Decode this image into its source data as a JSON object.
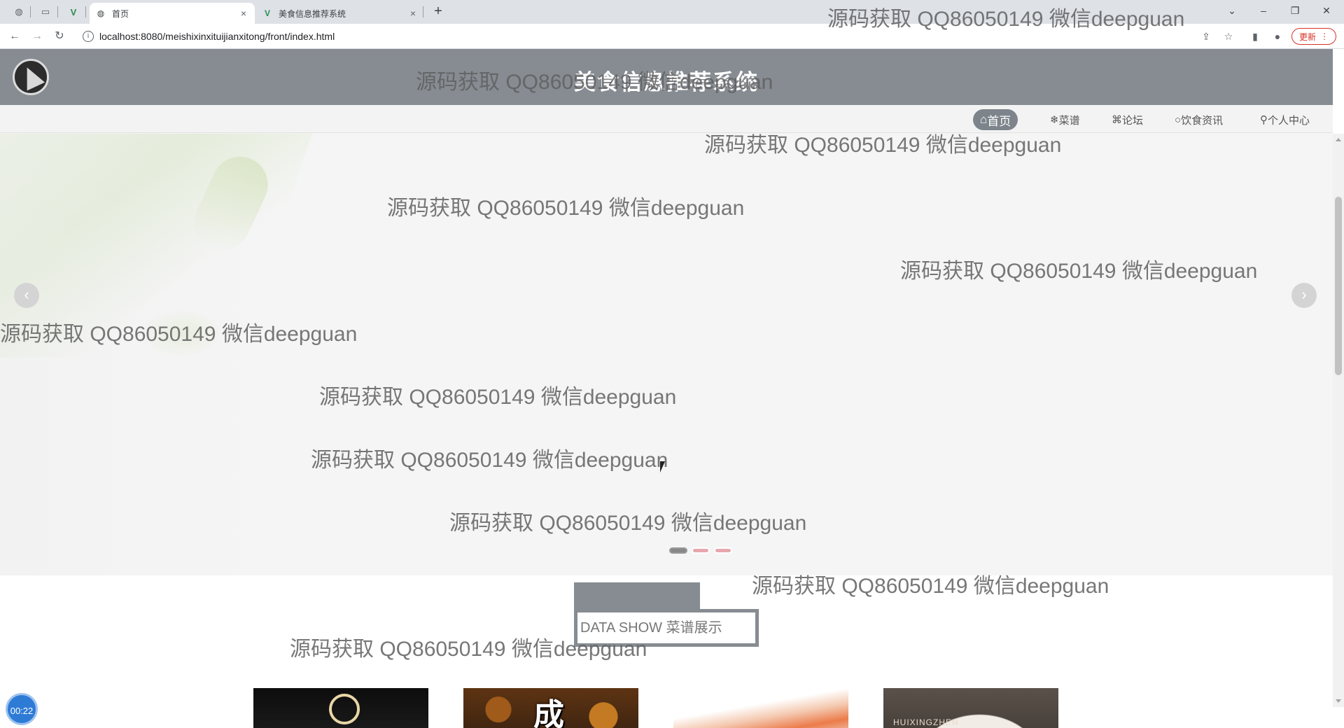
{
  "browser": {
    "tabs": [
      {
        "title": "首页",
        "active": true
      },
      {
        "title": "美食信息推荐系统",
        "active": false
      }
    ],
    "url": "localhost:8080/meishixinxituijianxitong/front/index.html",
    "update_label": "更新",
    "window_controls": {
      "minimize": "–",
      "restore": "❐",
      "close": "✕",
      "menu": "⌄"
    }
  },
  "site": {
    "title": "美食信息推荐系统",
    "nav": [
      {
        "icon": "⌂",
        "label": "首页",
        "active": true
      },
      {
        "icon": "❄",
        "label": "菜谱",
        "active": false
      },
      {
        "icon": "⌘",
        "label": "论坛",
        "active": false
      },
      {
        "icon": "○",
        "label": "饮食资讯",
        "active": false
      },
      {
        "icon": "⚲",
        "label": "个人中心",
        "active": false
      }
    ]
  },
  "banner": {
    "prev_arrow": "‹",
    "next_arrow": "›",
    "slide_count": 3,
    "active_slide": 1
  },
  "section": {
    "title": "DATA SHOW 菜谱展示"
  },
  "dishes": [
    {
      "overlay_text": ""
    },
    {
      "overlay_text": "成"
    },
    {
      "overlay_text": ""
    },
    {
      "overlay_text": "HUIXINGZHEN"
    }
  ],
  "recorder": {
    "time": "00:22"
  },
  "watermark_text": "源码获取 QQ86050149 微信deepguan"
}
